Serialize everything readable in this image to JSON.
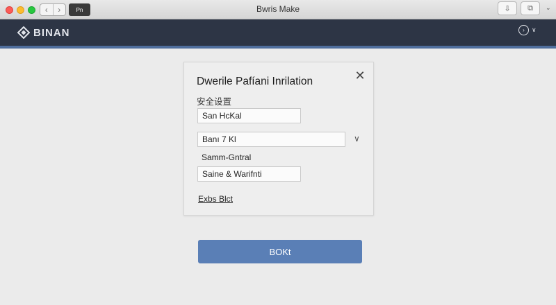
{
  "window": {
    "title": "Bwris Make",
    "tab_label": "Pn"
  },
  "header": {
    "brand": "BINAN",
    "brand_color": "#2d3545",
    "accent_color": "#4f6e9d"
  },
  "dialog": {
    "title": "Dwerile Pafíani Inrilation",
    "subtitle": "安全设置",
    "fields": {
      "field1_value": "San HcKal",
      "field2_value": "Banı 7 Kl",
      "field3_value": "Samm-Gntral",
      "field4_value": "Saine & Warifnti"
    },
    "link_label": "Exbs Blct"
  },
  "primary_button": {
    "label": "BOKt",
    "color": "#5a7fb6"
  },
  "icons": {
    "close": "close-icon",
    "dropdown": "chevron-down-icon",
    "account": "account-icon",
    "logo": "diamond-logo-icon"
  }
}
